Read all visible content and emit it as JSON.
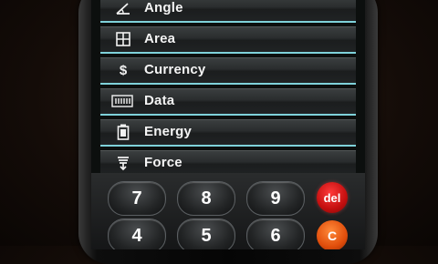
{
  "categories": [
    {
      "label": "Angle",
      "icon": "angle-icon"
    },
    {
      "label": "Area",
      "icon": "area-grid-icon"
    },
    {
      "label": "Currency",
      "icon": "dollar-icon"
    },
    {
      "label": "Data",
      "icon": "data-bits-icon"
    },
    {
      "label": "Energy",
      "icon": "battery-icon"
    },
    {
      "label": "Force",
      "icon": "force-icon"
    }
  ],
  "keypad": {
    "row1": [
      "7",
      "8",
      "9"
    ],
    "row2": [
      "4",
      "5",
      "6"
    ],
    "delete_label": "del",
    "clear_label": "C"
  },
  "colors": {
    "row_divider": "#7fd2da",
    "delete_button": "#c40f0f",
    "clear_button": "#e04d0b"
  }
}
